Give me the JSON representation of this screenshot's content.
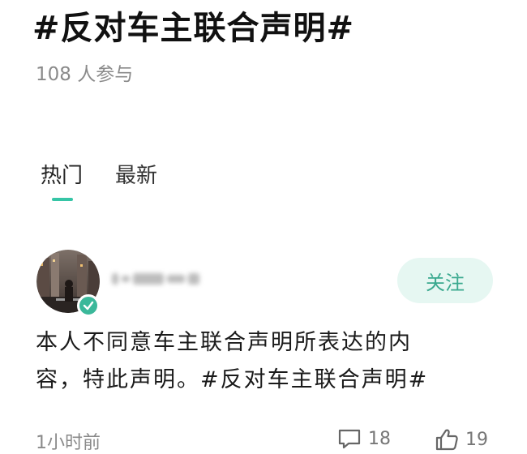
{
  "topic": {
    "title": "#反对车主联合声明#",
    "participants": "108 人参与"
  },
  "tabs": [
    {
      "label": "热门",
      "active": true
    },
    {
      "label": "最新",
      "active": false
    }
  ],
  "colors": {
    "accent": "#36c5a6",
    "follow_bg": "#e6f7f2",
    "follow_text": "#3aa98f",
    "muted": "#8a8a8a"
  },
  "post": {
    "follow_label": "关注",
    "body": "本人不同意车主联合声明所表达的内容，特此声明。#反对车主联合声明#",
    "time": "1小时前",
    "comments": "18",
    "likes": "19",
    "icons": {
      "comment": "comment-icon",
      "like": "thumbs-up-icon",
      "verified": "verified-check-icon"
    }
  }
}
